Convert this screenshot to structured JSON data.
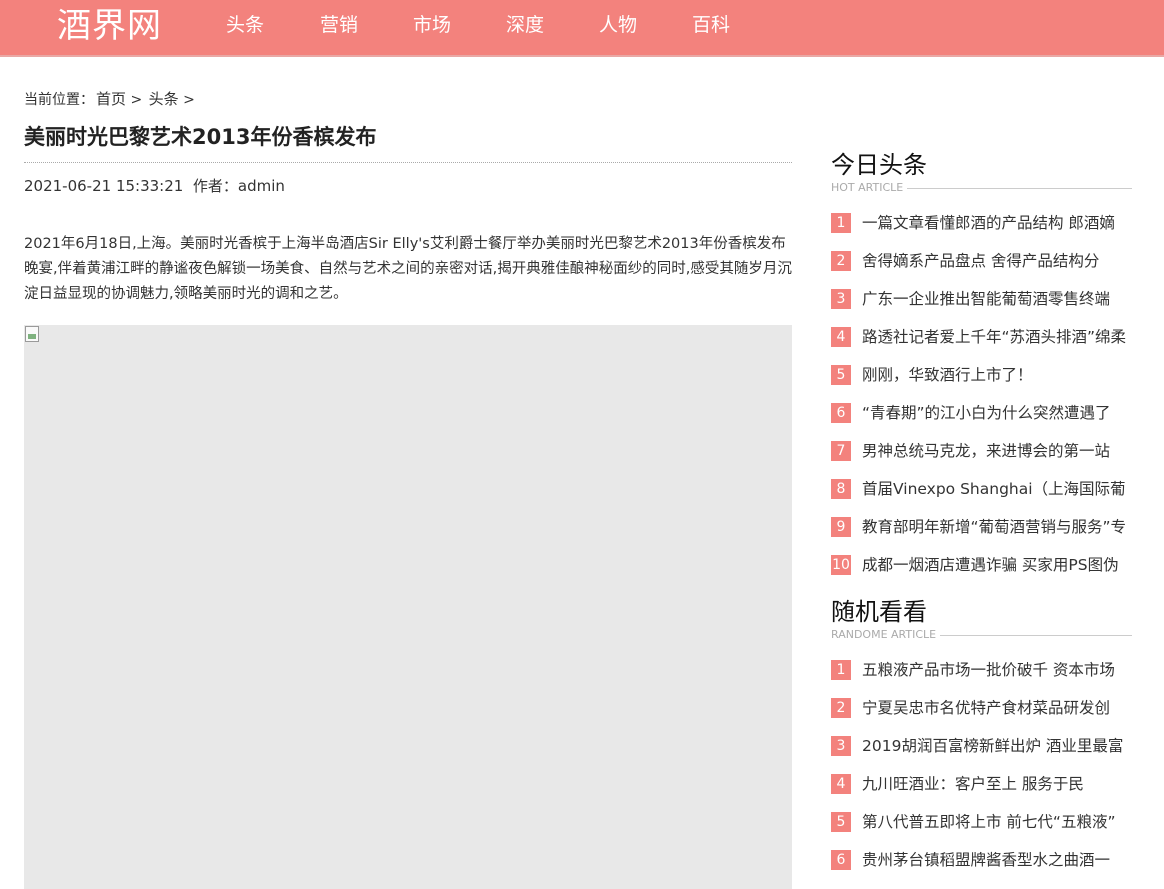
{
  "header": {
    "logo": "酒界网",
    "nav": [
      "头条",
      "营销",
      "市场",
      "深度",
      "人物",
      "百科"
    ]
  },
  "breadcrumb": {
    "prefix": "当前位置：",
    "home": "首页",
    "sep": ">",
    "section": "头条"
  },
  "article": {
    "title": "美丽时光巴黎艺术2013年份香槟发布",
    "date": "2021-06-21 15:33:21",
    "author_label": "作者：",
    "author": "admin",
    "body": "2021年6月18日,上海。美丽时光香槟于上海半岛酒店Sir Elly's艾利爵士餐厅举办美丽时光巴黎艺术2013年份香槟发布晚宴,伴着黄浦江畔的静谧夜色解锁一场美食、自然与艺术之间的亲密对话,揭开典雅佳酿神秘面纱的同时,感受其随岁月沉淀日益显现的协调魅力,领略美丽时光的调和之艺。"
  },
  "sidebar": {
    "today": {
      "title": "今日头条",
      "subtitle": "HOT ARTICLE",
      "items": [
        "一篇文章看懂郎酒的产品结构 郎酒嫡",
        "舍得嫡系产品盘点 舍得产品结构分",
        "广东一企业推出智能葡萄酒零售终端",
        "路透社记者爱上千年“苏酒头排酒”绵柔",
        "刚刚，华致酒行上市了！",
        "“青春期”的江小白为什么突然遭遇了",
        "男神总统马克龙，来进博会的第一站",
        "首届Vinexpo Shanghai（上海国际葡",
        "教育部明年新增“葡萄酒营销与服务”专",
        "成都一烟酒店遭遇诈骗 买家用PS图伪"
      ]
    },
    "random": {
      "title": "随机看看",
      "subtitle": "RANDOME ARTICLE",
      "items": [
        "五粮液产品市场一批价破千 资本市场",
        "宁夏吴忠市名优特产食材菜品研发创",
        "2019胡润百富榜新鲜出炉 酒业里最富",
        "九川旺酒业：客户至上 服务于民",
        "第八代普五即将上市 前七代“五粮液”",
        "贵州茅台镇稻盟牌酱香型水之曲酒一"
      ]
    }
  },
  "colors": {
    "accent": "#f3827d"
  }
}
